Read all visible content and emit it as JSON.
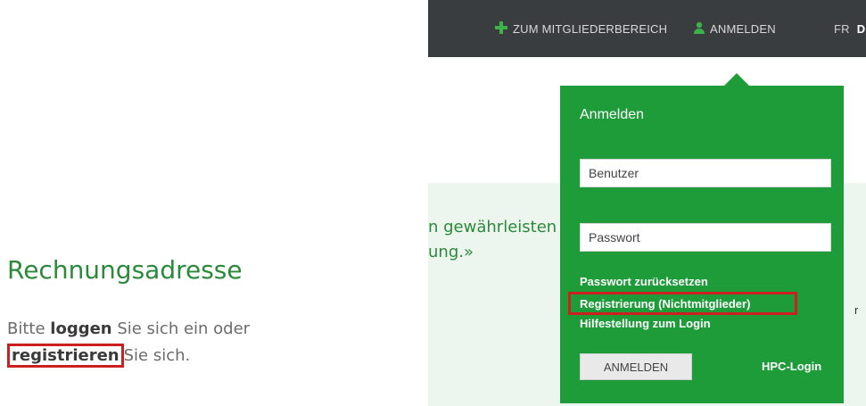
{
  "left": {
    "title": "Rechnungsadresse",
    "text_prefix": "Bitte",
    "text_login_word": "loggen",
    "text_middle": " Sie sich ein oder",
    "text_register_word": "registrieren",
    "text_suffix": "Sie sich."
  },
  "topbar": {
    "members_label": "ZUM MITGLIEDERBEREICH",
    "login_label": "ANMELDEN",
    "lang_fr": "FR",
    "lang_de": "DE"
  },
  "content": {
    "line1": "n gewährleisten",
    "line2": "ung.»",
    "side_letter": "r"
  },
  "login_dropdown": {
    "title": "Anmelden",
    "user_placeholder": "Benutzer",
    "password_placeholder": "Passwort",
    "reset_link": "Passwort zurücksetzen",
    "register_link": "Registrierung (Nichtmitglieder)",
    "help_link": "Hilfestellung zum Login",
    "submit_label": "ANMELDEN",
    "hpc_link": "HPC-Login"
  },
  "colors": {
    "brand_green": "#1e9c3a",
    "topbar_bg": "#3a3d3f",
    "highlight_red": "#cc1f1f"
  },
  "icons": {
    "members": "green-plus-icon",
    "login": "user-icon"
  }
}
